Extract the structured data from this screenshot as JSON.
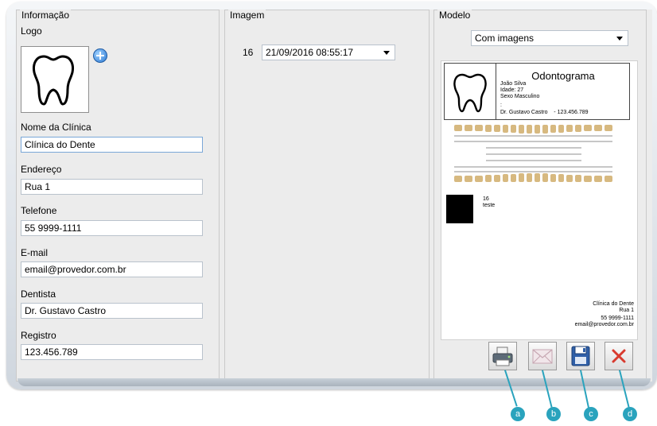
{
  "info": {
    "title": "Informação",
    "logo_label": "Logo",
    "clinic_label": "Nome da Clínica",
    "clinic_value": "Clínica do Dente",
    "address_label": "Endereço",
    "address_value": "Rua 1",
    "phone_label": "Telefone",
    "phone_value": "55 9999-1111",
    "email_label": "E-mail",
    "email_value": "email@provedor.com.br",
    "dentist_label": "Dentista",
    "dentist_value": "Dr. Gustavo Castro",
    "registry_label": "Registro",
    "registry_value": "123.456.789"
  },
  "image": {
    "title": "Imagem",
    "number": "16",
    "date_value": "21/09/2016 08:55:17"
  },
  "model": {
    "title": "Modelo",
    "selected": "Com imagens",
    "preview": {
      "heading": "Odontograma",
      "patient_name": "João Silva",
      "patient_age": "Idade: 27",
      "patient_sex": "Sexo Masculino",
      "colon": ":",
      "dentist_line": "Dr. Gustavo Castro    - 123.456.789",
      "entry_number": "16",
      "entry_text": "teste",
      "footer_clinic": "Clínica do Dente",
      "footer_address": "Rua 1",
      "footer_phone": "55 9999-1111",
      "footer_email": "email@provedor.com.br"
    }
  },
  "callouts": [
    "a",
    "b",
    "c",
    "d"
  ]
}
